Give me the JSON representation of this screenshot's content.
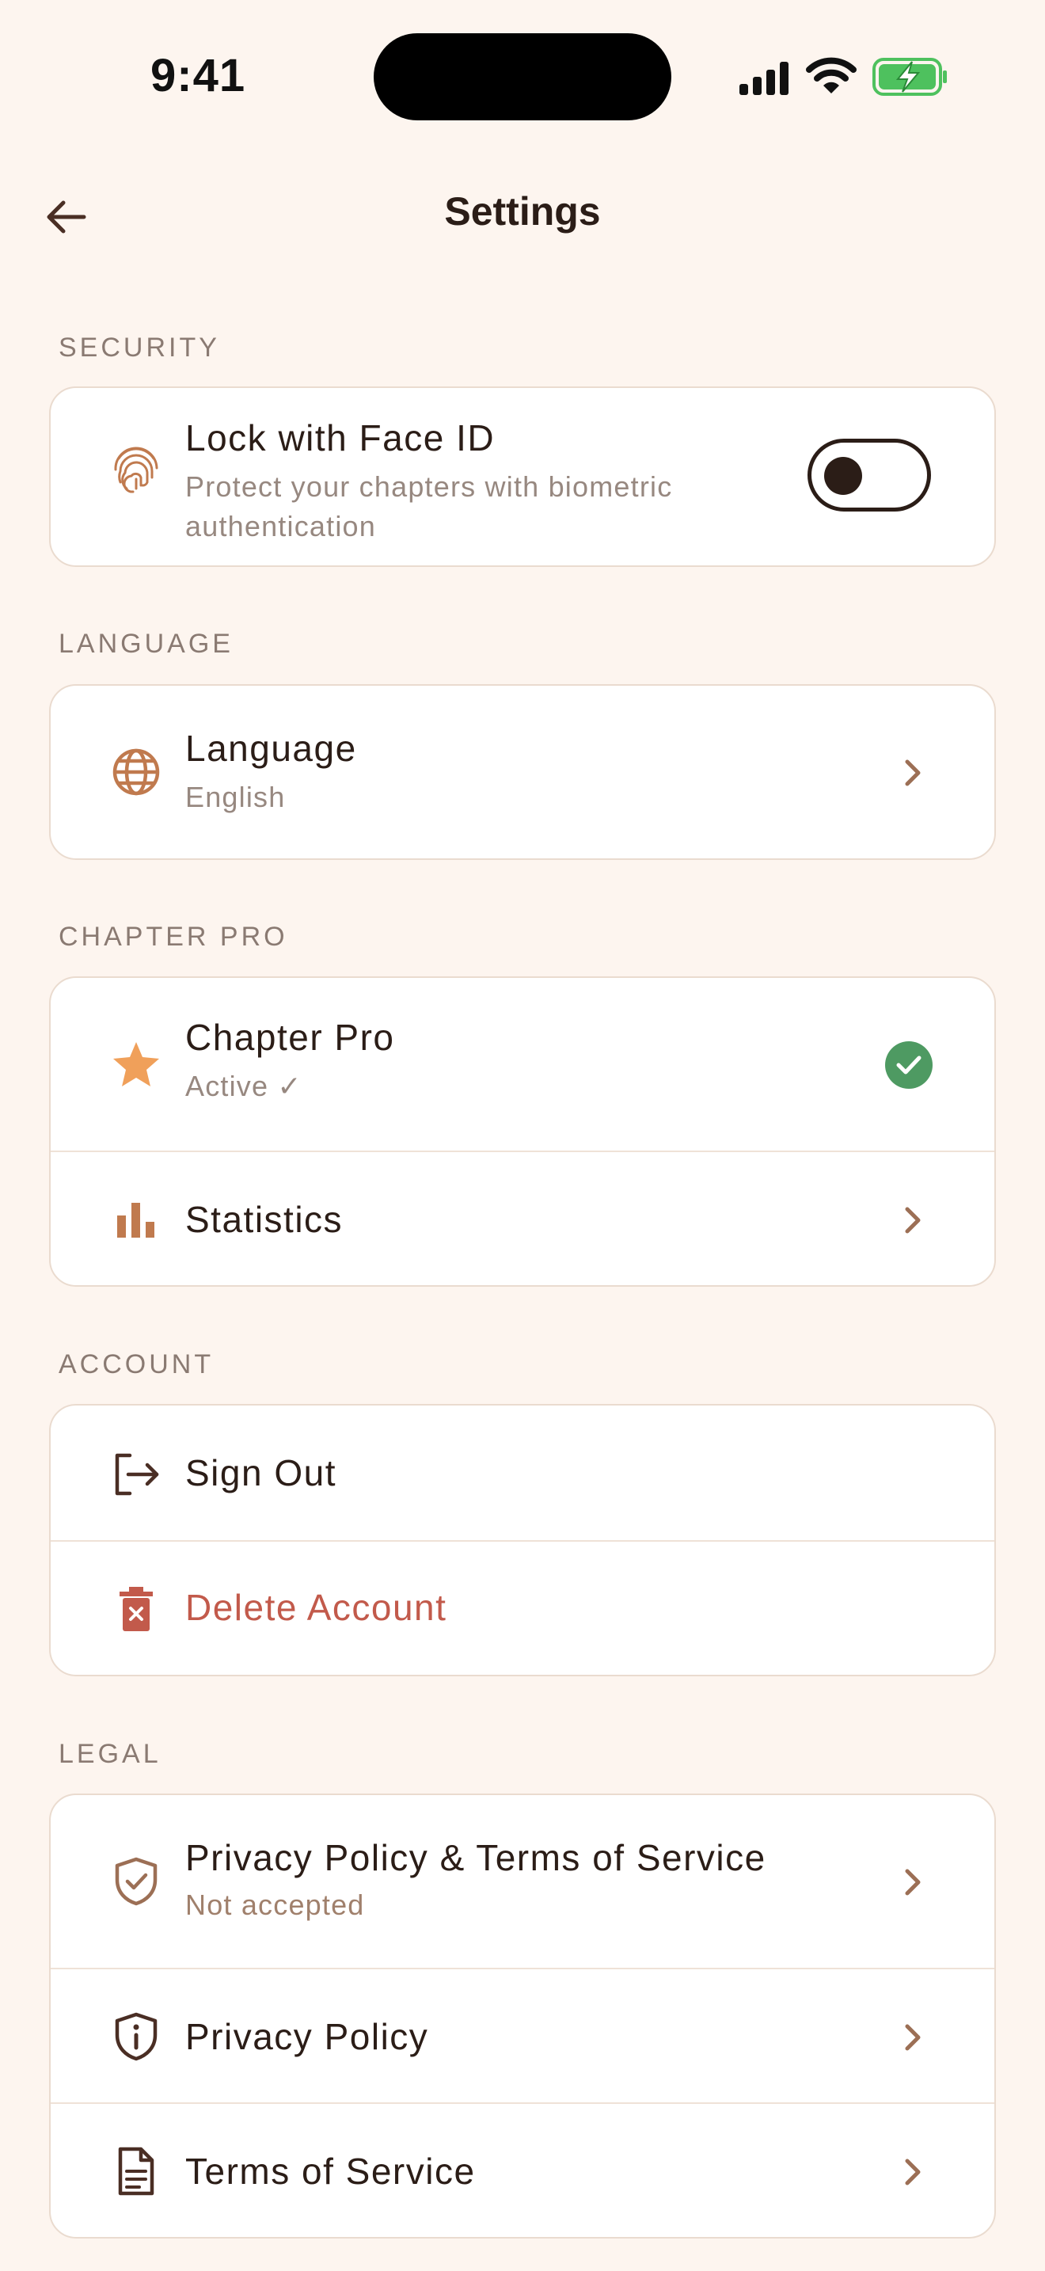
{
  "status_bar": {
    "time": "9:41"
  },
  "header": {
    "title": "Settings"
  },
  "sections": {
    "security": {
      "label": "SECURITY",
      "face_id": {
        "title": "Lock with Face ID",
        "subtitle": "Protect your chapters with biometric authentication",
        "toggle_on": false
      }
    },
    "language": {
      "label": "LANGUAGE",
      "item": {
        "title": "Language",
        "subtitle": "English"
      }
    },
    "chapter_pro": {
      "label": "CHAPTER PRO",
      "pro": {
        "title": "Chapter Pro",
        "subtitle": "Active ✓"
      },
      "stats": {
        "title": "Statistics"
      }
    },
    "account": {
      "label": "ACCOUNT",
      "sign_out": {
        "title": "Sign Out"
      },
      "delete": {
        "title": "Delete Account"
      }
    },
    "legal": {
      "label": "LEGAL",
      "privacy_terms": {
        "title": "Privacy Policy & Terms of Service",
        "subtitle": "Not accepted"
      },
      "privacy": {
        "title": "Privacy Policy"
      },
      "terms": {
        "title": "Terms of Service"
      }
    }
  },
  "colors": {
    "background": "#FDF5EF",
    "accent": "#C07A4E",
    "star": "#F0A05A",
    "success": "#4E9A62",
    "danger": "#C25A4B",
    "text": "#2B1D17",
    "muted": "#978880"
  },
  "icons": [
    "back-arrow-icon",
    "fingerprint-icon",
    "globe-icon",
    "star-icon",
    "bar-chart-icon",
    "sign-out-icon",
    "trash-icon",
    "shield-check-icon",
    "shield-info-icon",
    "document-icon",
    "chevron-right-icon",
    "check-circle-icon"
  ]
}
